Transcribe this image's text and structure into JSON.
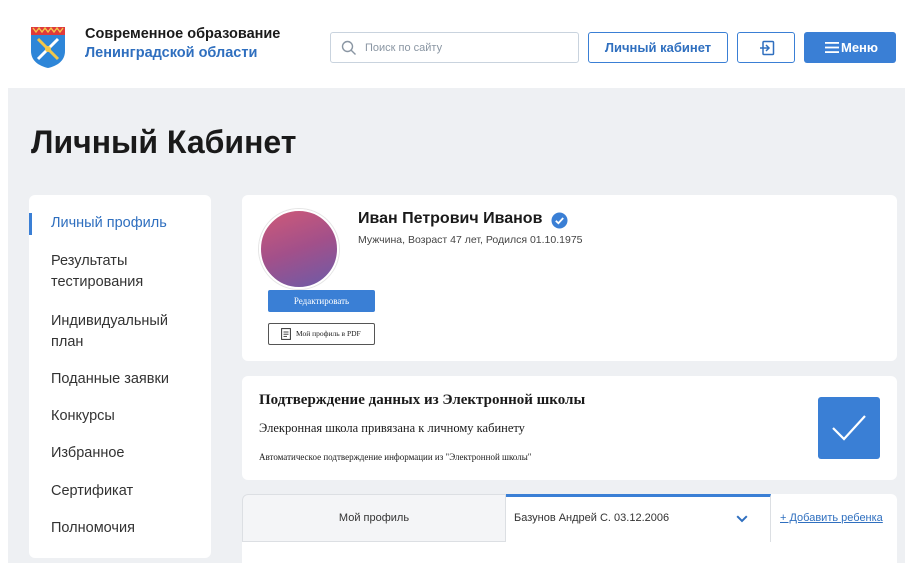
{
  "header": {
    "brand_line1": "Современное образование",
    "brand_line2": "Ленинградской области",
    "search_placeholder": "Поиск по сайту",
    "cabinet_button": "Личный кабинет",
    "menu_button": "Меню"
  },
  "page": {
    "title": "Личный Кабинет"
  },
  "sidebar": {
    "items": [
      {
        "label": "Личный профиль",
        "active": true
      },
      {
        "label": "Результаты тестирования",
        "active": false
      },
      {
        "label": "Индивидуальный план",
        "active": false
      },
      {
        "label": "Поданные заявки",
        "active": false
      },
      {
        "label": "Конкурсы",
        "active": false
      },
      {
        "label": "Избранное",
        "active": false
      },
      {
        "label": "Сертификат",
        "active": false
      },
      {
        "label": "Полномочия",
        "active": false
      }
    ]
  },
  "profile": {
    "name": "Иван Петрович Иванов",
    "info": "Мужчина, Возраст 47 лет, Родился 01.10.1975",
    "edit_button": "Редактировать",
    "pdf_button": "Мой профиль в PDF"
  },
  "school": {
    "title": "Подтверждение данных из Электронной школы",
    "subtitle": "Элекронная школа привязана к личному кабинету",
    "note": "Автоматическое подтверждение информации из \"Электронной школы\""
  },
  "tabs": {
    "my_profile": "Мой профиль",
    "child_selected": "Базунов Андрей С. 03.12.2006",
    "add_child": "+ Добавить ребенка"
  },
  "colors": {
    "accent": "#3a7fd5",
    "link": "#2f6fbf",
    "background": "#eef0f3"
  }
}
